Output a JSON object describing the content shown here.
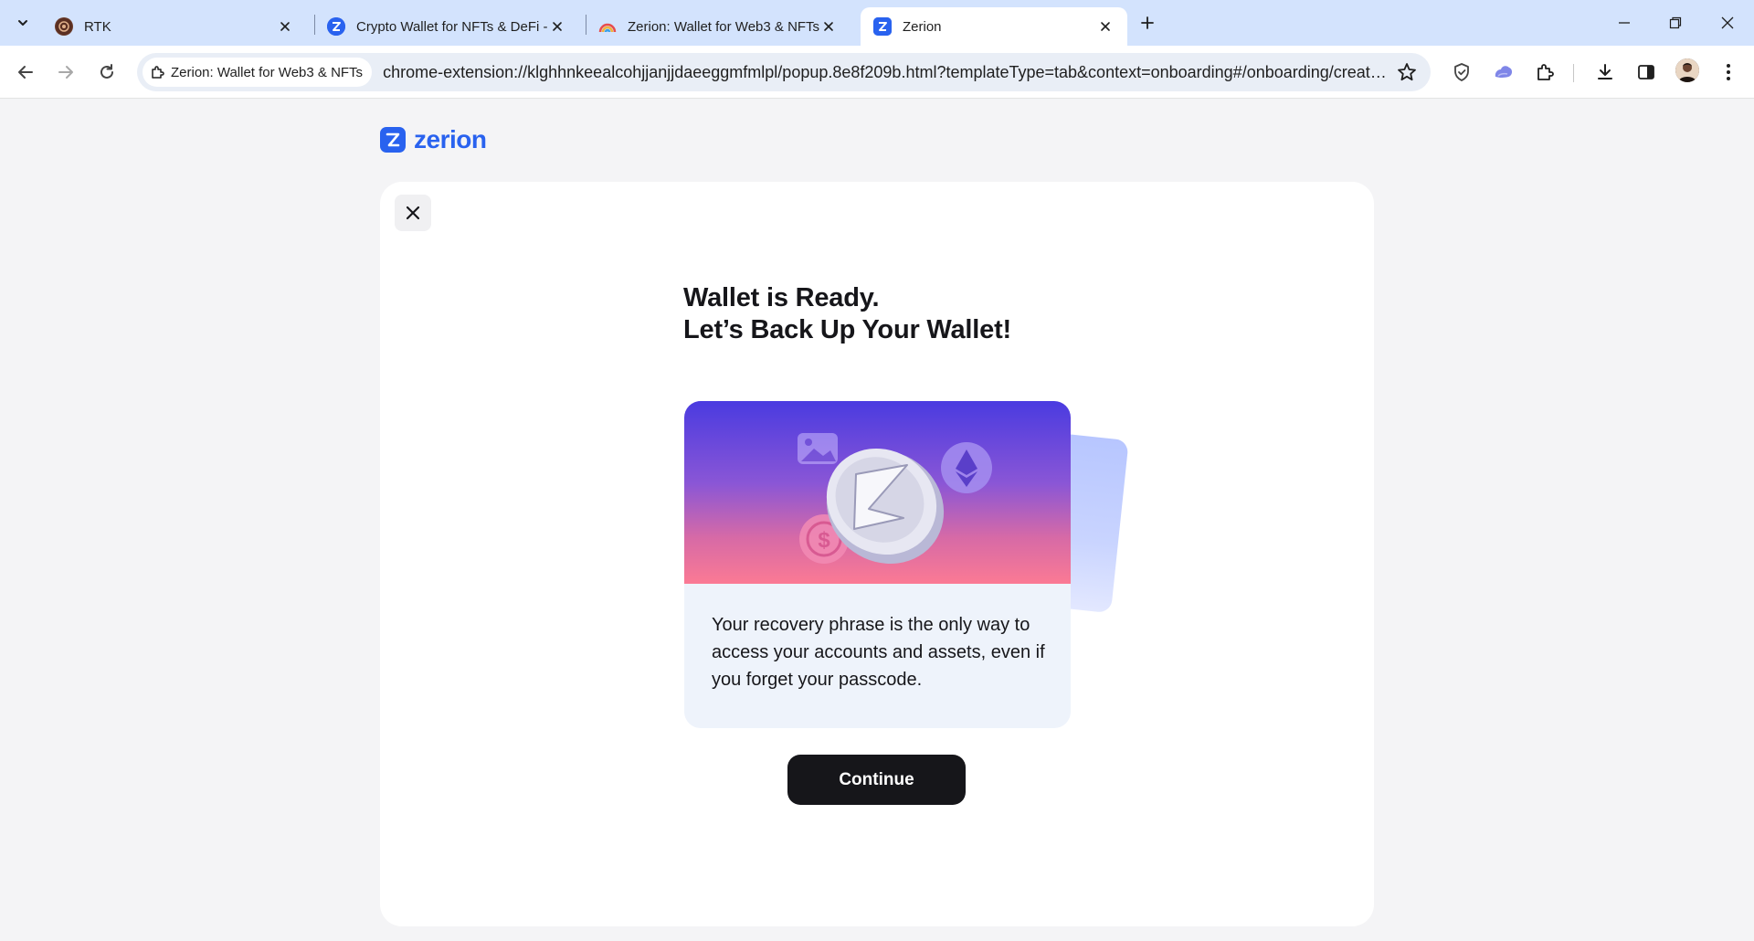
{
  "browser": {
    "tabs": [
      {
        "title": "RTK",
        "favicon": "rtk-icon"
      },
      {
        "title": "Crypto Wallet for NFTs & DeFi - ",
        "favicon": "zerion-icon"
      },
      {
        "title": "Zerion: Wallet for Web3 & NFTs",
        "favicon": "rainbow-icon"
      },
      {
        "title": "Zerion",
        "favicon": "zerion-icon",
        "active": true
      }
    ],
    "site_chip": "Zerion: Wallet for Web3 & NFTs",
    "url": "chrome-extension://klghhnkeealcohjjanjjdaeeggmfmlpl/popup.8e8f209b.html?templateType=tab&context=onboarding#/onboarding/create..."
  },
  "page": {
    "logo": "zerion",
    "heading_line1": "Wallet is Ready.",
    "heading_line2": "Let’s Back Up Your Wallet!",
    "description": "Your recovery phrase is the only way to access your accounts and assets, even if you forget your passcode.",
    "continue_label": "Continue"
  },
  "colors": {
    "tabstrip": "#d3e3fd",
    "brand": "#2962ef",
    "button": "#16161a"
  }
}
